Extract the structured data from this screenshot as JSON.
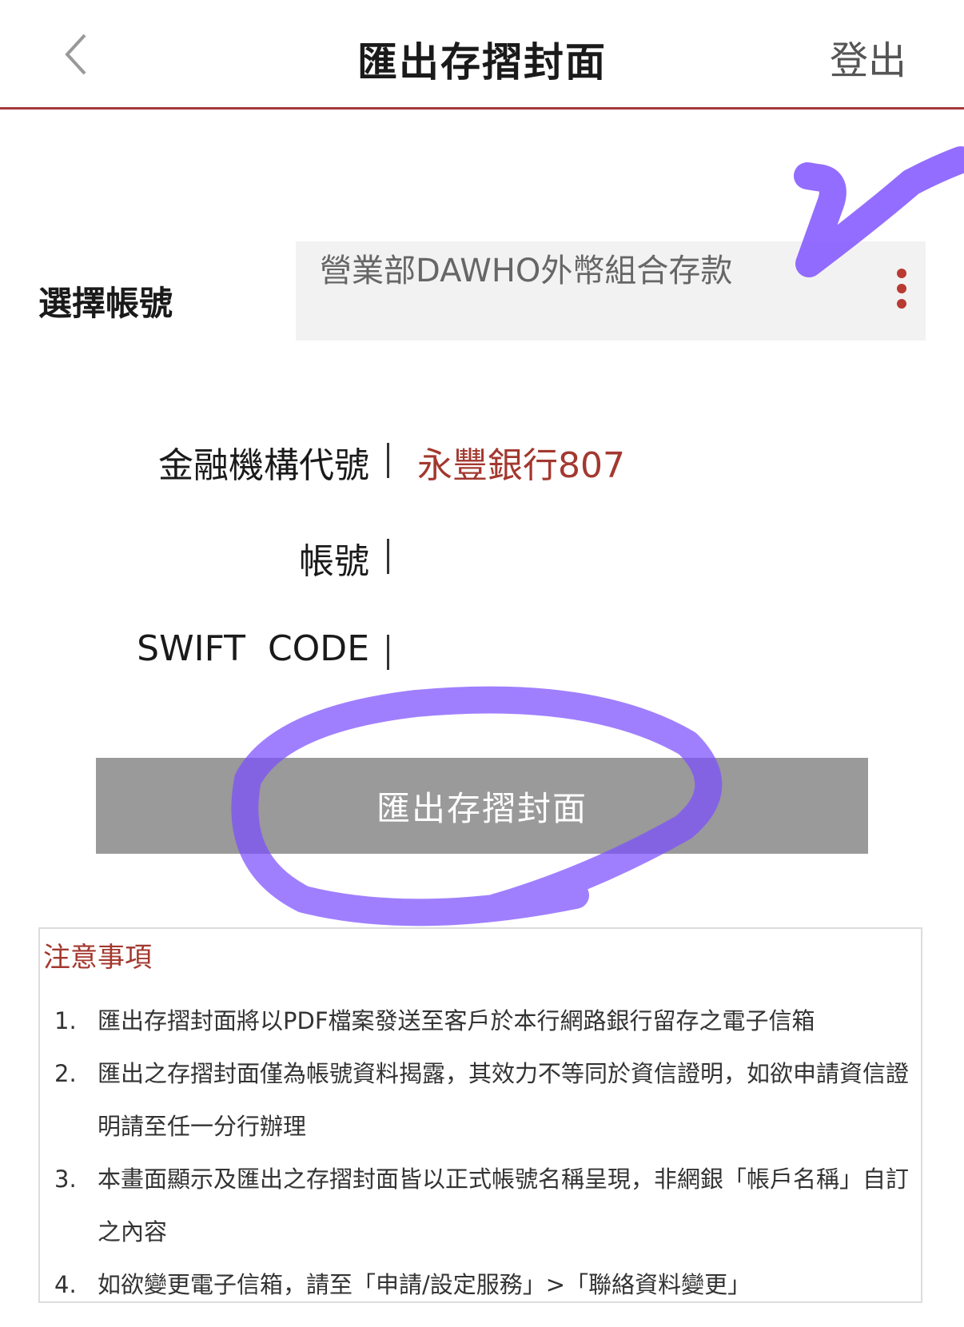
{
  "header": {
    "back_icon": "chevron-left-icon",
    "title": "匯出存摺封面",
    "logout_label": "登出"
  },
  "account_select": {
    "label": "選擇帳號",
    "value": "營業部DAWHO外幣組合存款",
    "menu_icon": "more-vertical-icon"
  },
  "info": {
    "bank_code_label": "金融機構代號",
    "bank_code_value": "永豐銀行807",
    "account_label": "帳號",
    "account_value": "",
    "swift_label": "SWIFT  CODE",
    "swift_value": ""
  },
  "export_button_label": "匯出存摺封面",
  "notes": {
    "title": "注意事項",
    "items": [
      {
        "num": "1.",
        "text": "匯出存摺封面將以PDF檔案發送至客戶於本行網路銀行留存之電子信箱"
      },
      {
        "num": "2.",
        "text": "匯出之存摺封面僅為帳號資料揭露，其效力不等同於資信證明，如欲申請資信證明請至任一分行辦理"
      },
      {
        "num": "3.",
        "text": "本畫面顯示及匯出之存摺封面皆以正式帳號名稱呈現，非網銀「帳戶名稱」自訂之內容"
      },
      {
        "num": "4.",
        "text": "如欲變更電子信箱，請至「申請/設定服務」>「聯絡資料變更」"
      }
    ]
  },
  "colors": {
    "accent": "#a3382f",
    "divider": "#a53a3a",
    "button_bg": "#9a9a9a",
    "annotation": "#7b4dff"
  }
}
